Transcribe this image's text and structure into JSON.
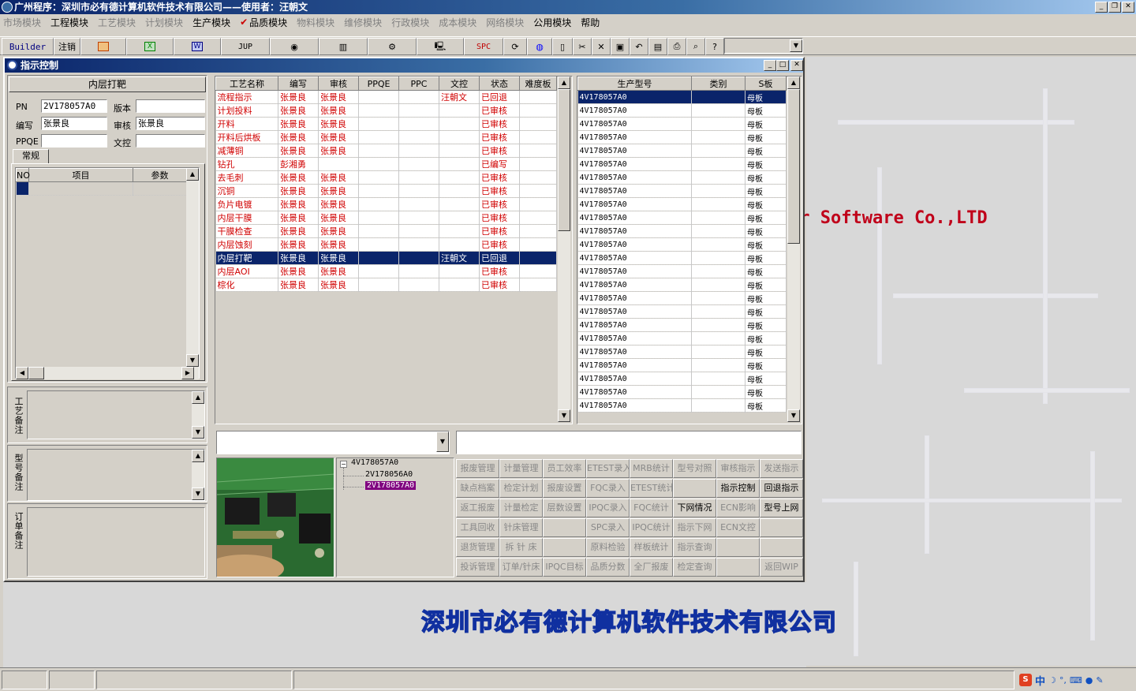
{
  "app": {
    "title": "广州程序：深圳市必有德计算机软件技术有限公司——使用者：汪朝文"
  },
  "menu": [
    {
      "label": "市场模块",
      "enabled": false
    },
    {
      "label": "工程模块",
      "enabled": true
    },
    {
      "label": "工艺模块",
      "enabled": false
    },
    {
      "label": "计划模块",
      "enabled": false
    },
    {
      "label": "生产模块",
      "enabled": true
    },
    {
      "label": "品质模块",
      "enabled": true,
      "checked": true
    },
    {
      "label": "物料模块",
      "enabled": false
    },
    {
      "label": "维修模块",
      "enabled": false
    },
    {
      "label": "行政模块",
      "enabled": false
    },
    {
      "label": "成本模块",
      "enabled": false
    },
    {
      "label": "网络模块",
      "enabled": false
    },
    {
      "label": "公用模块",
      "enabled": true
    },
    {
      "label": "帮助",
      "enabled": true
    }
  ],
  "toolbar": {
    "builder": "Builder",
    "logout": "注销",
    "jup": "JUP",
    "spc": "SPC"
  },
  "window": {
    "title": "指示控制"
  },
  "left": {
    "heading": "内层打靶",
    "pn_label": "PN",
    "pn": "2V178057A0",
    "version_label": "版本",
    "version": "",
    "editor_label": "编写",
    "editor": "张景良",
    "reviewer_label": "审核",
    "reviewer": "张景良",
    "ppqe_label": "PPQE",
    "ppqe": "",
    "docctrl_label": "文控",
    "docctrl": "",
    "tab": "常规",
    "params_headers": [
      "NO",
      "项目",
      "参数"
    ],
    "remark1": "工艺备注",
    "remark2": "型号备注",
    "remark3": "订单备注"
  },
  "process_table": {
    "headers": [
      "工艺名称",
      "编写",
      "审核",
      "PPQE",
      "PPC",
      "文控",
      "状态",
      "难度板"
    ],
    "rows": [
      [
        "流程指示",
        "张景良",
        "张景良",
        "",
        "",
        "汪朝文",
        "已回退",
        ""
      ],
      [
        "计划投料",
        "张景良",
        "张景良",
        "",
        "",
        "",
        "已审核",
        ""
      ],
      [
        "开料",
        "张景良",
        "张景良",
        "",
        "",
        "",
        "已审核",
        ""
      ],
      [
        "开料后烘板",
        "张景良",
        "张景良",
        "",
        "",
        "",
        "已审核",
        ""
      ],
      [
        "减薄铜",
        "张景良",
        "张景良",
        "",
        "",
        "",
        "已审核",
        ""
      ],
      [
        "钻孔",
        "彭湘勇",
        "",
        "",
        "",
        "",
        "已编写",
        ""
      ],
      [
        "去毛刺",
        "张景良",
        "张景良",
        "",
        "",
        "",
        "已审核",
        ""
      ],
      [
        "沉铜",
        "张景良",
        "张景良",
        "",
        "",
        "",
        "已审核",
        ""
      ],
      [
        "负片电镀",
        "张景良",
        "张景良",
        "",
        "",
        "",
        "已审核",
        ""
      ],
      [
        "内层干膜",
        "张景良",
        "张景良",
        "",
        "",
        "",
        "已审核",
        ""
      ],
      [
        "干膜检查",
        "张景良",
        "张景良",
        "",
        "",
        "",
        "已审核",
        ""
      ],
      [
        "内层蚀刻",
        "张景良",
        "张景良",
        "",
        "",
        "",
        "已审核",
        ""
      ],
      [
        "内层打靶",
        "张景良",
        "张景良",
        "",
        "",
        "汪朝文",
        "已回退",
        ""
      ],
      [
        "内层AOI",
        "张景良",
        "张景良",
        "",
        "",
        "",
        "已审核",
        ""
      ],
      [
        "棕化",
        "张景良",
        "张景良",
        "",
        "",
        "",
        "已审核",
        ""
      ]
    ],
    "selected": 12
  },
  "model_table": {
    "headers": [
      "生产型号",
      "类别",
      "S板"
    ],
    "rows": [
      [
        "4V178057A0",
        "",
        "母板"
      ],
      [
        "4V178057A0",
        "",
        "母板"
      ],
      [
        "4V178057A0",
        "",
        "母板"
      ],
      [
        "4V178057A0",
        "",
        "母板"
      ],
      [
        "4V178057A0",
        "",
        "母板"
      ],
      [
        "4V178057A0",
        "",
        "母板"
      ],
      [
        "4V178057A0",
        "",
        "母板"
      ],
      [
        "4V178057A0",
        "",
        "母板"
      ],
      [
        "4V178057A0",
        "",
        "母板"
      ],
      [
        "4V178057A0",
        "",
        "母板"
      ],
      [
        "4V178057A0",
        "",
        "母板"
      ],
      [
        "4V178057A0",
        "",
        "母板"
      ],
      [
        "4V178057A0",
        "",
        "母板"
      ],
      [
        "4V178057A0",
        "",
        "母板"
      ],
      [
        "4V178057A0",
        "",
        "母板"
      ],
      [
        "4V178057A0",
        "",
        "母板"
      ],
      [
        "4V178057A0",
        "",
        "母板"
      ],
      [
        "4V178057A0",
        "",
        "母板"
      ],
      [
        "4V178057A0",
        "",
        "母板"
      ],
      [
        "4V178057A0",
        "",
        "母板"
      ],
      [
        "4V178057A0",
        "",
        "母板"
      ],
      [
        "4V178057A0",
        "",
        "母板"
      ],
      [
        "4V178057A0",
        "",
        "母板"
      ],
      [
        "4V178057A0",
        "",
        "母板"
      ]
    ],
    "selected": 0
  },
  "tree": {
    "root": "4V178057A0",
    "children": [
      "2V178056A0",
      "2V178057A0"
    ],
    "selected": 1
  },
  "buttons": [
    [
      {
        "t": "报废管理"
      },
      {
        "t": "计量管理"
      },
      {
        "t": "员工效率"
      },
      {
        "t": "ETEST录入"
      },
      {
        "t": "MRB统计"
      },
      {
        "t": "型号对照"
      },
      {
        "t": "审核指示"
      },
      {
        "t": "发送指示"
      }
    ],
    [
      {
        "t": "缺点档案"
      },
      {
        "t": "检定计划"
      },
      {
        "t": "报废设置"
      },
      {
        "t": "FQC录入"
      },
      {
        "t": "ETEST统计"
      },
      {
        "t": ""
      },
      {
        "t": "指示控制",
        "on": true
      },
      {
        "t": "回退指示",
        "on": true
      }
    ],
    [
      {
        "t": "返工报废"
      },
      {
        "t": "计量检定"
      },
      {
        "t": "层数设置"
      },
      {
        "t": "IPQC录入"
      },
      {
        "t": "FQC统计"
      },
      {
        "t": "下网情况",
        "on": true
      },
      {
        "t": "ECN影响"
      },
      {
        "t": "型号上网",
        "on": true
      }
    ],
    [
      {
        "t": "工具回收"
      },
      {
        "t": "针床管理"
      },
      {
        "t": ""
      },
      {
        "t": "SPC录入"
      },
      {
        "t": "IPQC统计"
      },
      {
        "t": "指示下网"
      },
      {
        "t": "ECN文控"
      },
      {
        "t": ""
      }
    ],
    [
      {
        "t": "退货管理"
      },
      {
        "t": "拆 针 床"
      },
      {
        "t": ""
      },
      {
        "t": "原料检验"
      },
      {
        "t": "样板统计"
      },
      {
        "t": "指示查询"
      },
      {
        "t": ""
      },
      {
        "t": ""
      }
    ],
    [
      {
        "t": "投诉管理"
      },
      {
        "t": "订单/针床"
      },
      {
        "t": "IPQC目标"
      },
      {
        "t": "品质分数"
      },
      {
        "t": "全厂报废"
      },
      {
        "t": "检定查询"
      },
      {
        "t": ""
      },
      {
        "t": "返回WIP"
      }
    ]
  ],
  "desktop": {
    "software_text": "er Software Co.,LTD",
    "company_text": "深圳市必有德计算机软件技术有限公司"
  },
  "tray": {
    "ime": "中"
  }
}
